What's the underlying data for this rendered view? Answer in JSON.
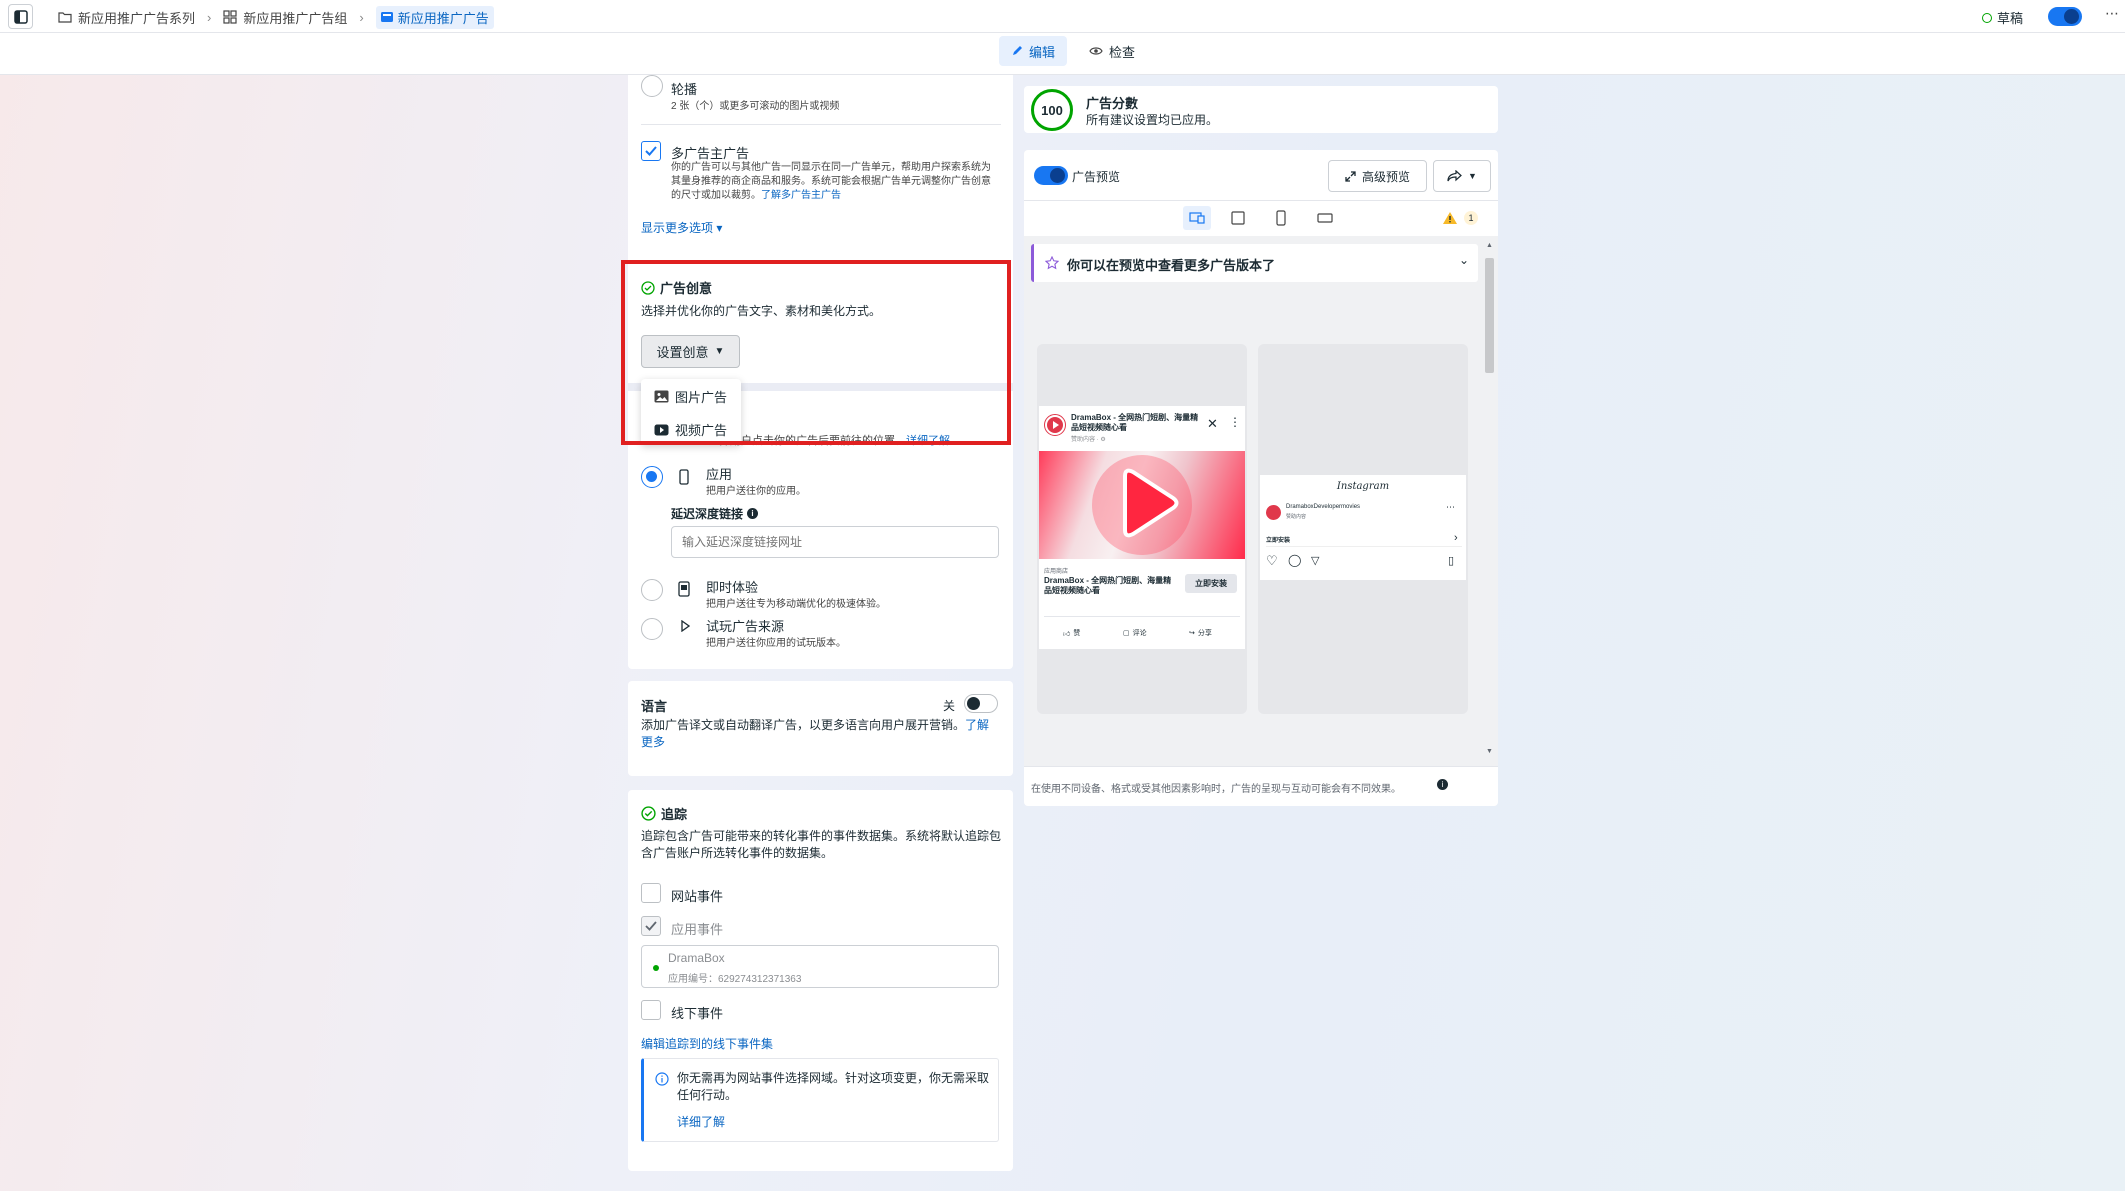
{
  "breadcrumb": {
    "campaign": "新应用推广广告系列",
    "adset": "新应用推广广告组",
    "ad": "新应用推广广告"
  },
  "status": {
    "draft": "草稿"
  },
  "modes": {
    "edit": "编辑",
    "review": "检查"
  },
  "format": {
    "carousel_title": "轮播",
    "carousel_desc": "2 张（个）或更多可滚动的图片或视频",
    "multi_advertiser_title": "多广告主广告",
    "multi_advertiser_desc": "你的广告可以与其他广告一同显示在同一广告单元，帮助用户探索系统为其量身推荐的商企商品和服务。系统可能会根据广告单元调整你广告创意的尺寸或加以裁剪。",
    "multi_advertiser_link": "了解多广告主广告",
    "more_options": "显示更多选项"
  },
  "creative": {
    "title": "广告创意",
    "desc": "选择并优化你的广告文字、素材和美化方式。",
    "setup_button": "设置创意",
    "menu": [
      "图片广告",
      "视频广告"
    ]
  },
  "destination": {
    "partial_desc": "选择用户点击你的广告后要前往的位置。",
    "partial_link": "详细了解",
    "app_title": "应用",
    "app_desc": "把用户送往你的应用。",
    "deep_link_label": "延迟深度链接",
    "deep_link_placeholder": "输入延迟深度链接网址",
    "instant_title": "即时体验",
    "instant_desc": "把用户送往专为移动端优化的极速体验。",
    "playable_title": "试玩广告来源",
    "playable_desc": "把用户送往你应用的试玩版本。"
  },
  "language": {
    "title": "语言",
    "toggle_label": "关",
    "desc": "添加广告译文或自动翻译广告，以更多语言向用户展开营销。",
    "link": "了解更多"
  },
  "tracking": {
    "title": "追踪",
    "desc": "追踪包含广告可能带来的转化事件的事件数据集。系统将默认追踪包含广告账户所选转化事件的数据集。",
    "website_events": "网站事件",
    "app_events": "应用事件",
    "app_name": "DramaBox",
    "app_id": "应用编号：629274312371363",
    "offline_events": "线下事件",
    "edit_offline_link": "编辑追踪到的线下事件集",
    "info_text": "你无需再为网站事件选择网域。针对这项变更，你无需采取任何行动。",
    "info_link": "详细了解"
  },
  "score": {
    "value": "100",
    "title": "广告分數",
    "desc": "所有建议设置均已应用。"
  },
  "preview": {
    "toggle_label": "广告预览",
    "advanced_button": "高级预览",
    "warning_count": "1",
    "banner_text": "你可以在预览中查看更多广告版本了",
    "fb": {
      "page_name": "DramaBox - 全网热门短剧、海量精品短视频随心看",
      "sponsored": "赞助内容 · ⚙",
      "store": "应用商店",
      "headline": "DramaBox - 全网热门短剧、海量精品短视频随心看",
      "cta": "立即安装",
      "like": "赞",
      "comment": "评论",
      "share": "分享"
    },
    "ig": {
      "logo": "Instagram",
      "account": "DramaboxDevelopermovies",
      "sponsored": "赞助内容",
      "cta": "立即安装"
    },
    "footer": "在使用不同设备、格式或受其他因素影响时，广告的呈现与互动可能会有不同效果。"
  },
  "colors": {
    "accent": "#1877f2",
    "highlight": "#e02020",
    "score_ring": "#00a400"
  }
}
